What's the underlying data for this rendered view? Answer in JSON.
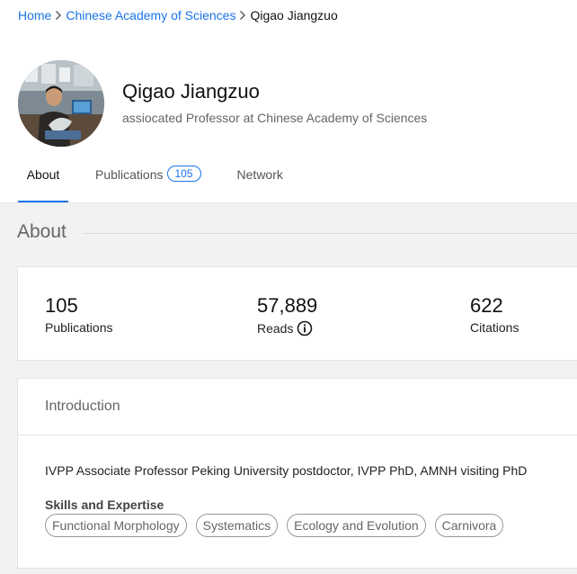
{
  "breadcrumb": {
    "home": "Home",
    "institution": "Chinese Academy of Sciences",
    "current": "Qigao Jiangzuo"
  },
  "profile": {
    "name": "Qigao Jiangzuo",
    "affiliation": "assiocated Professor at Chinese Academy of Sciences"
  },
  "tabs": {
    "about": "About",
    "publications": "Publications",
    "publications_count": "105",
    "network": "Network",
    "active": "about"
  },
  "about": {
    "title": "About",
    "stats": [
      {
        "value": "105",
        "label": "Publications"
      },
      {
        "value": "57,889",
        "label": "Reads"
      },
      {
        "value": "622",
        "label": "Citations"
      }
    ]
  },
  "introduction": {
    "title": "Introduction",
    "text": "IVPP Associate Professor Peking University postdoctor, IVPP PhD, AMNH visiting PhD",
    "skills_label": "Skills and Expertise",
    "skills": [
      "Functional Morphology",
      "Systematics",
      "Ecology and Evolution",
      "Carnivora"
    ]
  },
  "icons": {
    "breadcrumb_separator": "chevron-right-icon",
    "reads_info": "info-icon"
  },
  "colors": {
    "link": "#1a73e8",
    "background": "#f2f2f2"
  }
}
